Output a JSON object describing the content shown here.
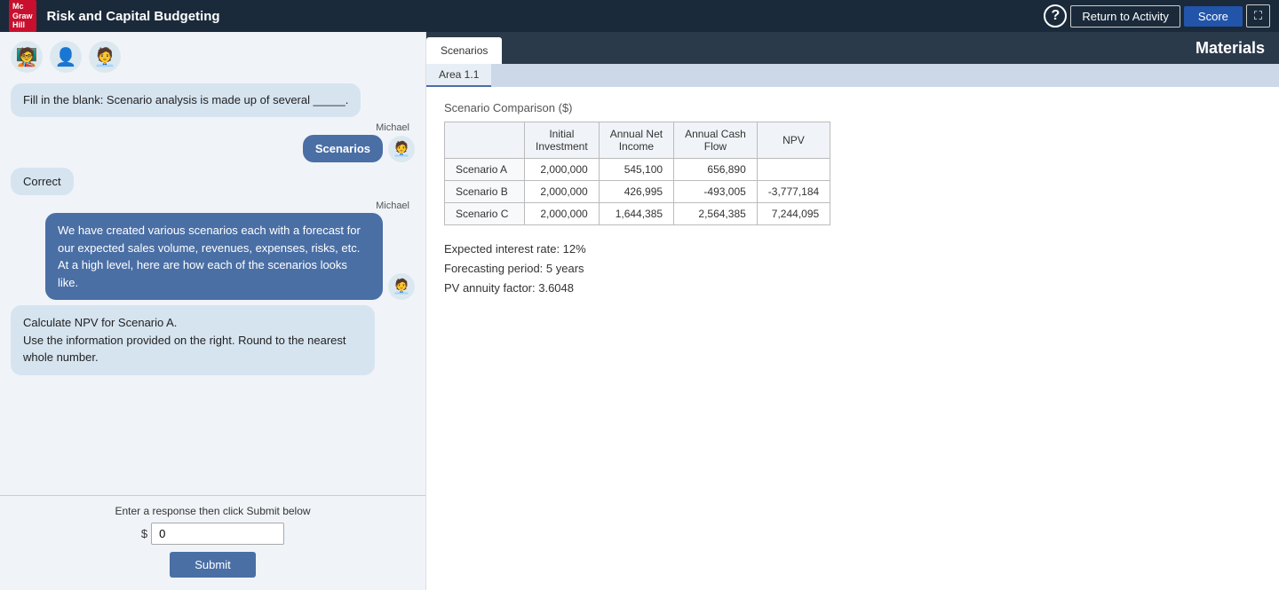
{
  "navbar": {
    "logo_line1": "Mc",
    "logo_line2": "Graw",
    "logo_line3": "Hill",
    "title": "Risk and Capital Budgeting",
    "help_label": "?",
    "return_label": "Return to Activity",
    "score_label": "Score",
    "expand_label": "⛶"
  },
  "left_panel": {
    "avatars": [
      "🧑‍💼",
      "👤",
      "🧑‍💼"
    ],
    "fill_blank_prompt": "Fill in the blank: Scenario analysis is made up of several _____.",
    "user_label": "Michael",
    "user_answer": "Scenarios",
    "correct_label": "Correct",
    "michael_label": "Michael",
    "michael_message": "We have created various scenarios each with a forecast for our expected sales volume, revenues, expenses, risks, etc.\nAt a high level, here are how each of the scenarios looks like.",
    "question_line1": "Calculate NPV for Scenario A.",
    "question_line2": "Use the information provided on the right. Round to the nearest whole number.",
    "input_label": "Enter a response then click Submit below",
    "dollar_sign": "$",
    "input_value": "0",
    "submit_label": "Submit"
  },
  "right_panel": {
    "tab_scenarios": "Scenarios",
    "tab_title": "Materials",
    "sub_tab_area": "Area 1.1",
    "table_title": "Scenario Comparison ($)",
    "table_headers": [
      "",
      "Initial Investment",
      "Annual Net Income",
      "Annual Cash Flow",
      "NPV"
    ],
    "table_rows": [
      {
        "label": "Scenario A",
        "initial": "2,000,000",
        "net_income": "545,100",
        "cash_flow": "656,890",
        "npv": ""
      },
      {
        "label": "Scenario B",
        "initial": "2,000,000",
        "net_income": "426,995",
        "cash_flow": "-493,005",
        "npv": "-3,777,184"
      },
      {
        "label": "Scenario C",
        "initial": "2,000,000",
        "net_income": "1,644,385",
        "cash_flow": "2,564,385",
        "npv": "7,244,095"
      }
    ],
    "info_interest": "Expected interest rate: 12%",
    "info_period": "Forecasting period: 5 years",
    "info_pv": "PV annuity factor: 3.6048"
  }
}
